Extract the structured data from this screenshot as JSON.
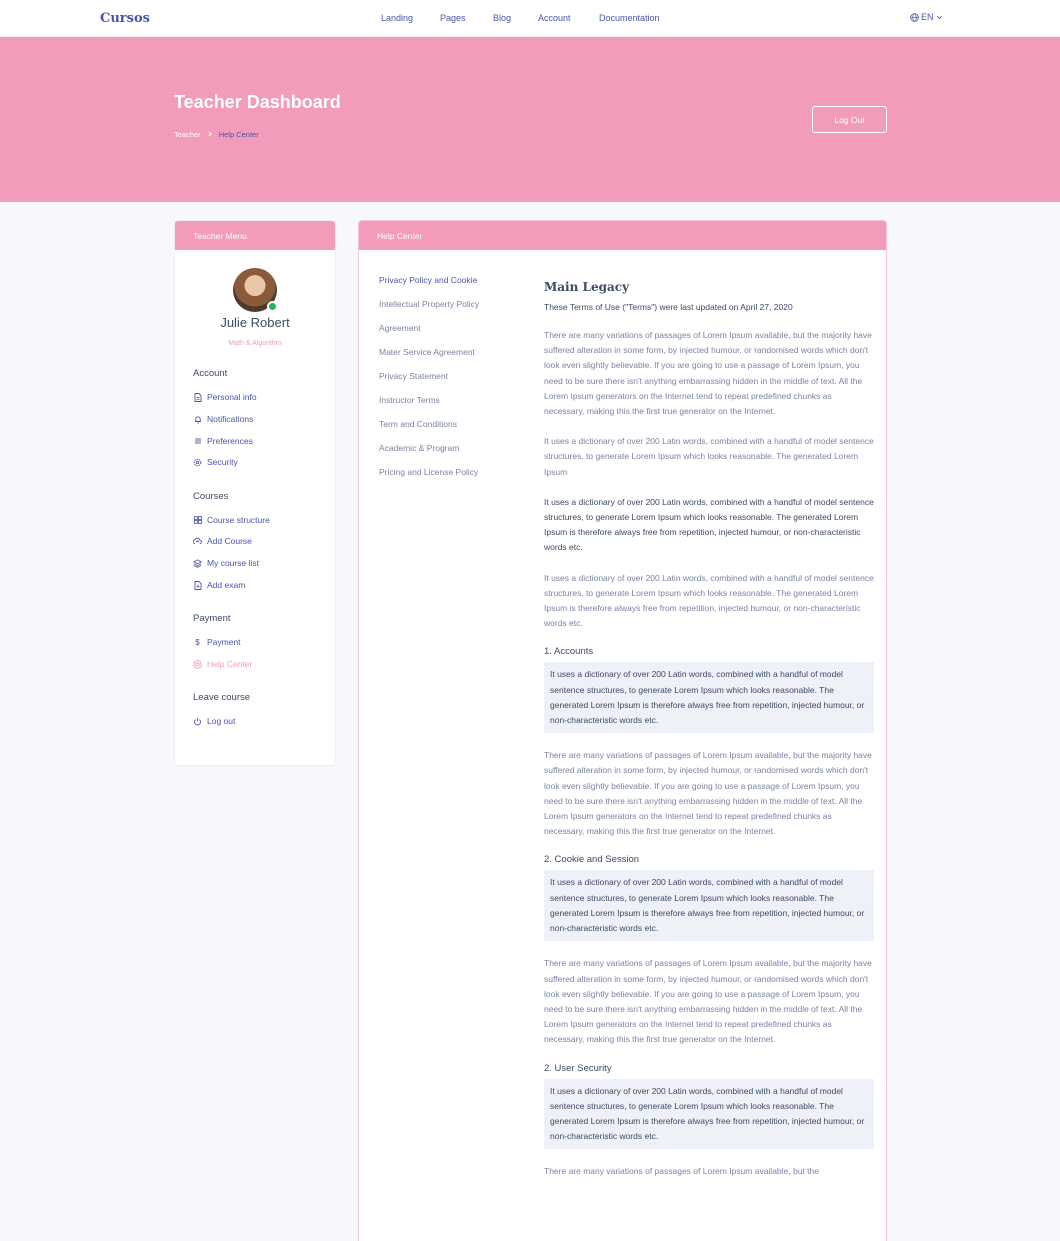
{
  "nav": {
    "brand": "Cursos",
    "links": [
      "Landing",
      "Pages",
      "Blog",
      "Account",
      "Documentation"
    ],
    "language": "EN"
  },
  "hero": {
    "title": "Teacher Dashboard",
    "breadcrumb": [
      "Teacher",
      "Help Center"
    ],
    "logout_label": "Log Out"
  },
  "sidebar": {
    "header": "Teacher Menu",
    "user_name": "Julie Robert",
    "user_role": "Math & Algorithm",
    "sections": [
      {
        "title": "Account",
        "items": [
          {
            "label": "Personal info",
            "icon": "file-icon"
          },
          {
            "label": "Notifications",
            "icon": "bell-icon"
          },
          {
            "label": "Preferences",
            "icon": "list-icon"
          },
          {
            "label": "Security",
            "icon": "gear-icon"
          }
        ]
      },
      {
        "title": "Courses",
        "items": [
          {
            "label": "Course structure",
            "icon": "grid-icon"
          },
          {
            "label": "Add Course",
            "icon": "cloud-upload-icon"
          },
          {
            "label": "My course list",
            "icon": "layers-icon"
          },
          {
            "label": "Add exam",
            "icon": "file-plus-icon"
          }
        ]
      },
      {
        "title": "Payment",
        "items": [
          {
            "label": "Payment",
            "icon": "dollar-icon"
          },
          {
            "label": "Help Center",
            "icon": "help-icon"
          }
        ]
      },
      {
        "title": "Leave course",
        "items": [
          {
            "label": "Log out",
            "icon": "power-icon"
          }
        ]
      }
    ]
  },
  "main": {
    "header": "Help Center",
    "subnav": [
      "Privacy Policy and Cookie",
      "Intellectual Property Policy",
      "Agreement",
      "Mater Service Agreement",
      "Privacy Statement",
      "Instructor Terms",
      "Term and Conditions",
      "Academic & Program",
      "Pricing and License Policy"
    ],
    "title": "Main Legacy",
    "updated": "These Terms of Use (\"Terms\") were last updated on April 27, 2020",
    "para_long": "There are many variations of passages of Lorem Ipsum available, but the majority have suffered alteration in some form, by injected humour, or randomised words which don't look even slightly believable. If you are going to use a passage of Lorem Ipsum, you need to be sure there isn't anything embarrassing hidden in the middle of text. All the Lorem Ipsum generators on the Internet tend to repeat predefined chunks as necessary, making this the first true generator on the Internet.",
    "para_short": "It uses a dictionary of over 200 Latin words, combined with a handful of model sentence structures, to generate Lorem Ipsum which looks reasonable. The generated Lorem Ipsum",
    "para_full": "It uses a dictionary of over 200 Latin words, combined with a handful of model sentence structures, to generate Lorem Ipsum which looks reasonable. The generated Lorem Ipsum is therefore always free from repetition, injected humour, or non-characteristic words etc.",
    "para_full_2": "It uses a dictionary of over 200 Latin words, combined with a handful of model sentence structures, to generate Lorem Ipsum which looks reasonable. The generated Lorem Ipsum is therefore always free from repetition, injected humour, or non-characteristic words etc.",
    "sections": [
      {
        "heading": "1. Accounts",
        "box": "It uses a dictionary of over 200 Latin words, combined with a handful of model sentence structures, to generate Lorem Ipsum which looks reasonable. The generated Lorem Ipsum is therefore always free from repetition, injected humour, or non-characteristic words etc.",
        "para": "There are many variations of passages of Lorem Ipsum available, but the majority have suffered alteration in some form, by injected humour, or randomised words which don't look even slightly believable. If you are going to use a passage of Lorem Ipsum, you need to be sure there isn't anything embarrassing hidden in the middle of text. All the Lorem Ipsum generators on the Internet tend to repeat predefined chunks as necessary, making this the first true generator on the Internet."
      },
      {
        "heading": "2. Cookie and Session",
        "box": "It uses a dictionary of over 200 Latin words, combined with a handful of model sentence structures, to generate Lorem Ipsum which looks reasonable. The generated Lorem Ipsum is therefore always free from repetition, injected humour, or non-characteristic words etc.",
        "para": "There are many variations of passages of Lorem Ipsum available, but the majority have suffered alteration in some form, by injected humour, or randomised words which don't look even slightly believable. If you are going to use a passage of Lorem Ipsum, you need to be sure there isn't anything embarrassing hidden in the middle of text. All the Lorem Ipsum generators on the Internet tend to repeat predefined chunks as necessary, making this the first true generator on the Internet."
      },
      {
        "heading": "2. User Security",
        "box": "It uses a dictionary of over 200 Latin words, combined with a handful of model sentence structures, to generate Lorem Ipsum which looks reasonable. The generated Lorem Ipsum is therefore always free from repetition, injected humour, or non-characteristic words etc.",
        "para": "There are many variations of passages of Lorem Ipsum available, but the"
      }
    ]
  },
  "colors": {
    "accent": "#f29bbb",
    "brand": "#4b55a8",
    "online": "#27b35b",
    "box_bg": "#eef1f7"
  }
}
